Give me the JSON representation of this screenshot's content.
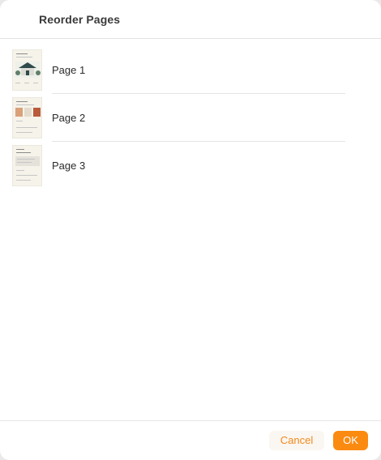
{
  "dialog": {
    "title": "Reorder Pages"
  },
  "pages": [
    {
      "label": "Page 1",
      "thumbnail_icon": "house-page-thumbnail-icon"
    },
    {
      "label": "Page 2",
      "thumbnail_icon": "color-swatches-page-thumbnail-icon"
    },
    {
      "label": "Page 3",
      "thumbnail_icon": "text-form-page-thumbnail-icon"
    }
  ],
  "footer": {
    "cancel_label": "Cancel",
    "ok_label": "OK"
  },
  "colors": {
    "accent": "#fb8a10",
    "cancel_text": "#f08a1c"
  }
}
